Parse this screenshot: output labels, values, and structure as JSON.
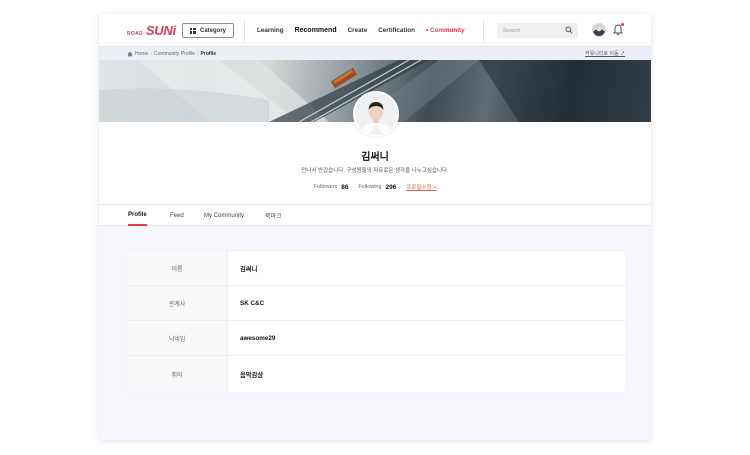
{
  "header": {
    "logo_small": "ROAD",
    "logo_main": "SUNi",
    "category_label": "Category",
    "nav": [
      "Learning",
      "Recommend",
      "Create",
      "Certification",
      "Community"
    ],
    "search_placeholder": "Search"
  },
  "breadcrumb": {
    "items": [
      "Home",
      "Community Profile",
      "Profile"
    ],
    "right_link": "커뮤니티로 이동 ↗"
  },
  "profile": {
    "name": "김써니",
    "intro": "만나서 반갑습니다. 구성원들의 자유로운 생각을 나누고싶습니다.",
    "followers_label": "Followers",
    "followers_count": "86",
    "following_label": "Following",
    "following_count": "296",
    "edit_label": "프로필수정 >"
  },
  "tabs": [
    "Profile",
    "Feed",
    "My Community",
    "북마크"
  ],
  "info": [
    {
      "key": "이름",
      "value": "김써니"
    },
    {
      "key": "관계사",
      "value": "SK C&C"
    },
    {
      "key": "닉네임",
      "value": "awesome29"
    },
    {
      "key": "취미",
      "value": "음악감상"
    }
  ],
  "colors": {
    "accent": "#e53a4e",
    "edit_link": "#e0623a",
    "page_bg": "#f4f6fb"
  }
}
